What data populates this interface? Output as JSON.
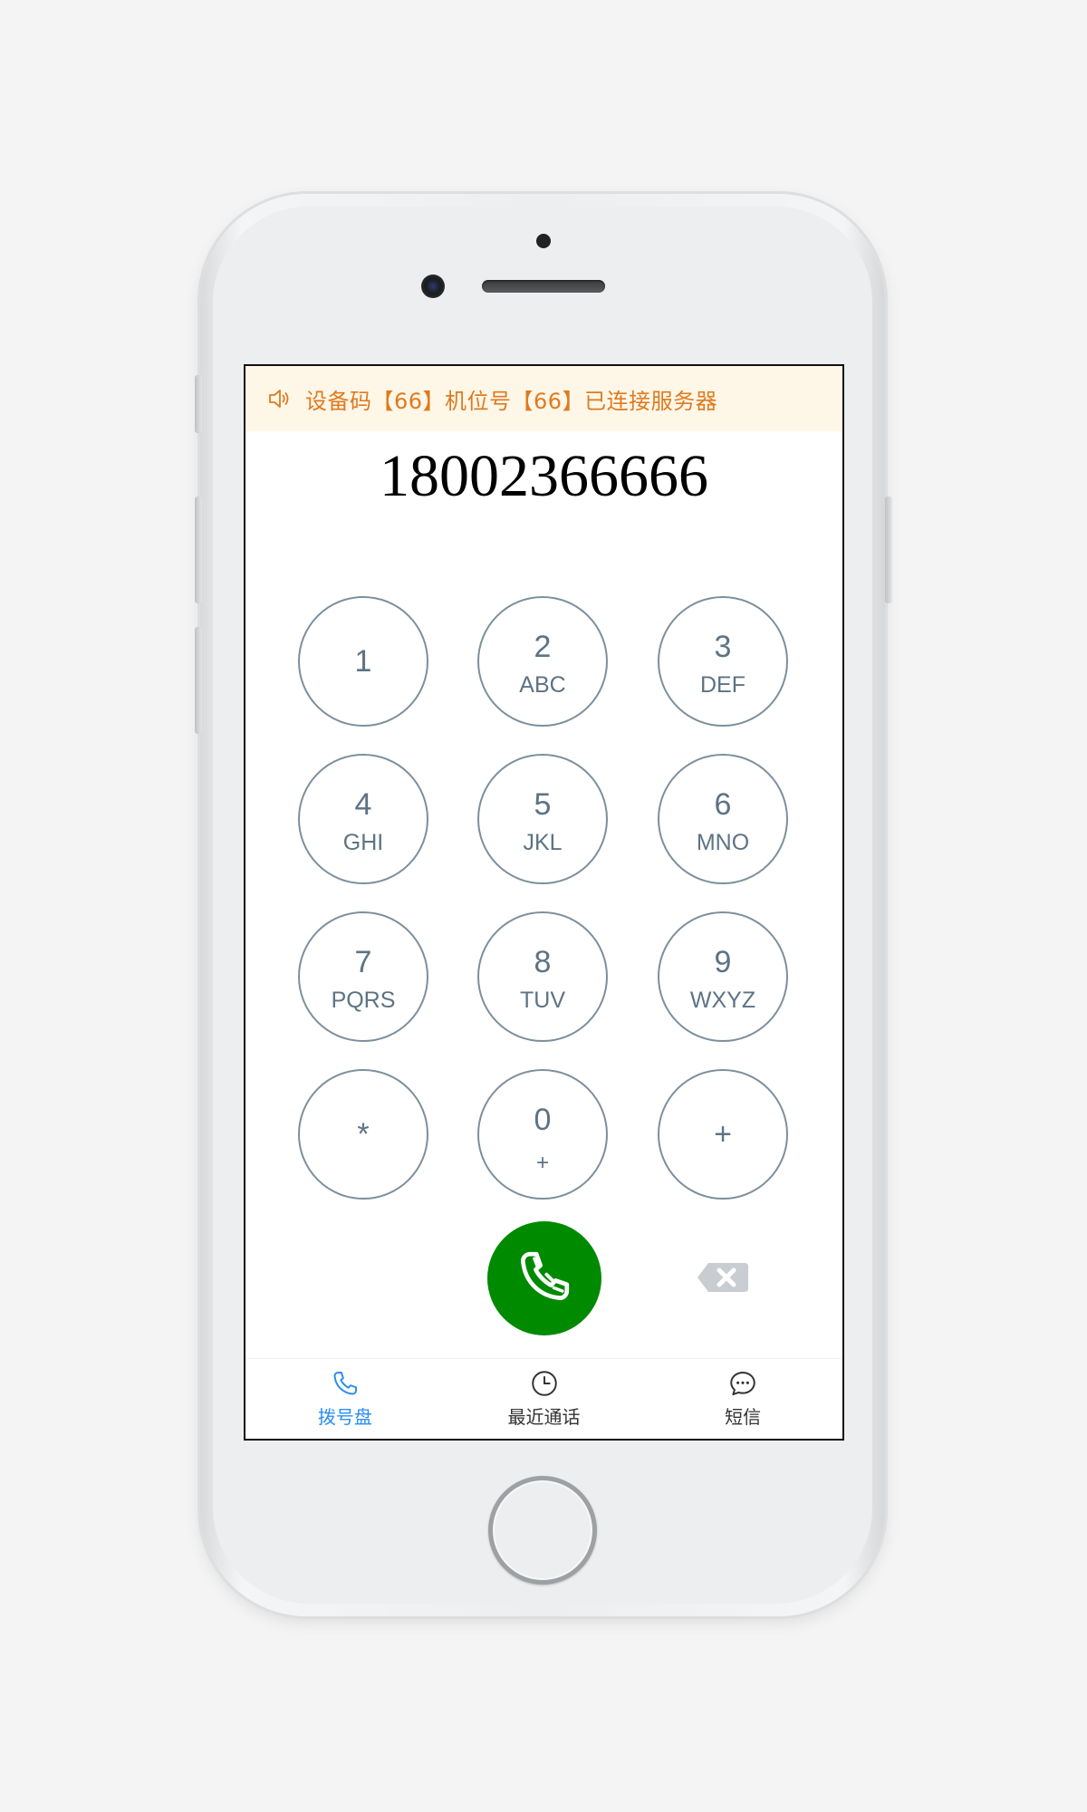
{
  "notice": {
    "icon": "speaker-icon",
    "text": "设备码【66】机位号【66】已连接服务器",
    "color": "#e07a1f",
    "background": "#fef7e8"
  },
  "dialer": {
    "number": "18002366666"
  },
  "keypad": {
    "keys": [
      {
        "digit": "1",
        "letters": ""
      },
      {
        "digit": "2",
        "letters": "ABC"
      },
      {
        "digit": "3",
        "letters": "DEF"
      },
      {
        "digit": "4",
        "letters": "GHI"
      },
      {
        "digit": "5",
        "letters": "JKL"
      },
      {
        "digit": "6",
        "letters": "MNO"
      },
      {
        "digit": "7",
        "letters": "PQRS"
      },
      {
        "digit": "8",
        "letters": "TUV"
      },
      {
        "digit": "9",
        "letters": "WXYZ"
      },
      {
        "digit": "*",
        "letters": ""
      },
      {
        "digit": "0",
        "letters": "+"
      },
      {
        "digit": "+",
        "letters": ""
      }
    ],
    "key_color": "#5d7384"
  },
  "actions": {
    "call_icon": "phone-icon",
    "call_color": "#008a00",
    "backspace_icon": "backspace-icon"
  },
  "tabs": [
    {
      "label": "拨号盘",
      "icon": "phone-icon",
      "active": true
    },
    {
      "label": "最近通话",
      "icon": "clock-icon",
      "active": false
    },
    {
      "label": "短信",
      "icon": "message-icon",
      "active": false
    }
  ],
  "accent_color": "#2a8ef0"
}
